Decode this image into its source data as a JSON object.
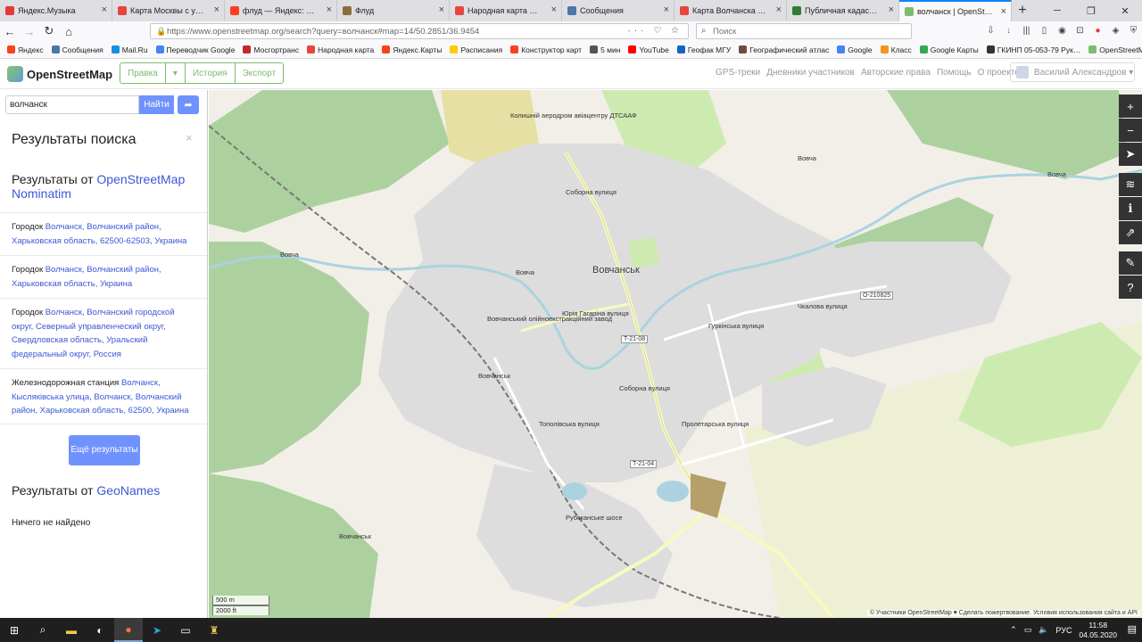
{
  "browser": {
    "tabs": [
      {
        "label": "Яндекс.Музыка",
        "color": "#e53935",
        "active": false
      },
      {
        "label": "Карта Москвы с улица…",
        "color": "#e8453c",
        "active": false
      },
      {
        "label": "флуд — Яндекс: нашло…",
        "color": "#fc3f1d",
        "active": false
      },
      {
        "label": "Флуд",
        "color": "#8a6d3b",
        "active": false
      },
      {
        "label": "Народная карта — ред…",
        "color": "#e8453c",
        "active": false
      },
      {
        "label": "Сообщения",
        "color": "#4a76a8",
        "active": false
      },
      {
        "label": "Карта Волчанска с ули…",
        "color": "#e8453c",
        "active": false
      },
      {
        "label": "Публичная кадастрова…",
        "color": "#2e7d32",
        "active": false
      },
      {
        "label": "волчанск | OpenStreetM…",
        "color": "#7ebc6f",
        "active": true
      }
    ],
    "url": "https://www.openstreetmap.org/search?query=волчанск#map=14/50.2851/36.9454",
    "search_placeholder": "Поиск",
    "bookmarks": [
      {
        "label": "Яндекс",
        "color": "#fc3f1d"
      },
      {
        "label": "Сообщения",
        "color": "#4a76a8"
      },
      {
        "label": "Mail.Ru",
        "color": "#168de2"
      },
      {
        "label": "Переводчик Google",
        "color": "#4285f4"
      },
      {
        "label": "Мосгортранс",
        "color": "#c62828"
      },
      {
        "label": "Народная карта",
        "color": "#e8453c"
      },
      {
        "label": "Яндекс.Карты",
        "color": "#fc3f1d"
      },
      {
        "label": "Расписания",
        "color": "#ffcc00"
      },
      {
        "label": "Конструктор карт",
        "color": "#fc3f1d"
      },
      {
        "label": "5 мин",
        "color": "#555555"
      },
      {
        "label": "YouTube",
        "color": "#ff0000"
      },
      {
        "label": "Геофак МГУ",
        "color": "#1565c0"
      },
      {
        "label": "Географический атлас",
        "color": "#6d4c41"
      },
      {
        "label": "Google",
        "color": "#4285f4"
      },
      {
        "label": "Класс",
        "color": "#f7931e"
      },
      {
        "label": "Google Карты",
        "color": "#34a853"
      },
      {
        "label": "ГКИНП 05-053-79 Рук…",
        "color": "#333333"
      },
      {
        "label": "OpenStreetMap",
        "color": "#7ebc6f"
      }
    ]
  },
  "osm": {
    "logo_text": "OpenStreetMap",
    "edit_buttons": [
      "Правка",
      "▾",
      "История",
      "Экспорт"
    ],
    "nav_links": [
      "GPS-треки",
      "Дневники участников",
      "Авторские права",
      "Помощь",
      "О проекте"
    ],
    "user_name": "Василий Александров ▾",
    "accent_color": "#7ebc6f",
    "button_color": "#7092ff"
  },
  "sidebar": {
    "search_value": "волчанск",
    "search_button": "Найти",
    "results_title": "Результаты поиска",
    "provider1_prefix": "Результаты от ",
    "provider1_name": "OpenStreetMap Nominatim",
    "results": [
      {
        "type": "Городок",
        "link": "Волчанск, Волчанский район, Харьковская область, 62500-62503, Украина"
      },
      {
        "type": "Городок",
        "link": "Волчанск, Волчанский район, Харьковская область, Украина"
      },
      {
        "type": "Городок",
        "link": "Волчанск, Волчанский городской округ, Северный управленческий округ, Свердловская область, Уральский федеральный округ, Россия"
      },
      {
        "type": "Железнодорожная станция",
        "link": "Волчанск, Кысляківська улица, Волчанск, Волчанский район, Харьковская область, 62500, Украина"
      }
    ],
    "more_button": "Ещё результаты",
    "provider2_prefix": "Результаты от ",
    "provider2_name": "GeoNames",
    "no_results": "Ничего не найдено"
  },
  "map": {
    "town_label": "Вовчанськ",
    "labels": [
      "Колишній аеродром авіацентру ДТСААФ",
      "Вовчанський олійноекстракційний завод",
      "Вовчанськ",
      "Вовча",
      "Вовча",
      "Вовча",
      "Вовча",
      "Соборна вулиця",
      "Соборна вулиця",
      "Юрія Гагаріна вулиця",
      "Чкалова вулиця",
      "Гуркінська вулиця",
      "Пролетарська вулиця",
      "Тополівська вулиця",
      "Рубіжанське шосе",
      "Вовчанськ"
    ],
    "shields": [
      "T-21-08",
      "T-21-04",
      "O-210825"
    ],
    "scale_metric": "500 m",
    "scale_imperial": "2000 ft",
    "attribution": "© Участники OpenStreetMap ♥ Сделать пожертвование. Условия использования сайта и API",
    "controls": [
      "zoom-in",
      "zoom-out",
      "locate",
      "layers",
      "info",
      "share",
      "note",
      "query"
    ]
  },
  "taskbar": {
    "lang": "РУС",
    "time": "11:58",
    "date": "04.05.2020"
  }
}
